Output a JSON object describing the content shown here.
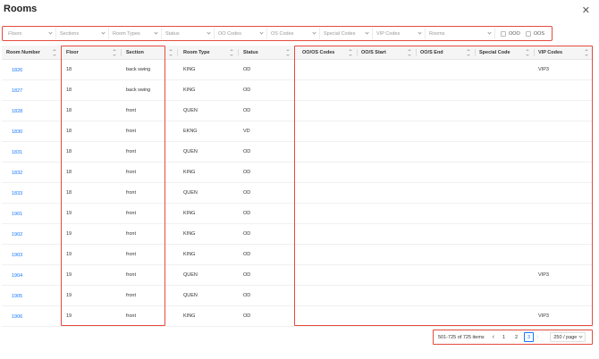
{
  "modal": {
    "title": "Rooms",
    "close_glyph": "✕"
  },
  "filters": {
    "floors": "Floors",
    "sections": "Sections",
    "room_types": "Room Types",
    "status": "Status",
    "oo_codes": "OO Codes",
    "os_codes": "OS Codes",
    "special_codes": "Special Codes",
    "vip_codes": "VIP Codes",
    "rooms": "Rooms",
    "ooo": "OOO",
    "oos": "OOS"
  },
  "columns": {
    "room_number": "Room Number",
    "floor": "Floor",
    "section": "Section",
    "room_type": "Room Type",
    "status": "Status",
    "oo_os_codes": "OO/OS Codes",
    "oo_s_start": "OO/S Start",
    "oo_s_end": "OO/S End",
    "special_code": "Special Code",
    "vip_codes": "VIP Codes"
  },
  "rows": [
    {
      "room": "1826",
      "floor": "18",
      "section": "back swing",
      "type": "KING",
      "status": "OD",
      "vip": "VIP3"
    },
    {
      "room": "1827",
      "floor": "18",
      "section": "back swing",
      "type": "KING",
      "status": "OD",
      "vip": ""
    },
    {
      "room": "1828",
      "floor": "18",
      "section": "front",
      "type": "QUEN",
      "status": "OD",
      "vip": ""
    },
    {
      "room": "1830",
      "floor": "18",
      "section": "front",
      "type": "EKNG",
      "status": "VD",
      "vip": ""
    },
    {
      "room": "1831",
      "floor": "18",
      "section": "front",
      "type": "QUEN",
      "status": "OD",
      "vip": ""
    },
    {
      "room": "1832",
      "floor": "18",
      "section": "front",
      "type": "KING",
      "status": "OD",
      "vip": ""
    },
    {
      "room": "1833",
      "floor": "18",
      "section": "front",
      "type": "QUEN",
      "status": "OD",
      "vip": ""
    },
    {
      "room": "1901",
      "floor": "19",
      "section": "front",
      "type": "KING",
      "status": "OD",
      "vip": ""
    },
    {
      "room": "1902",
      "floor": "19",
      "section": "front",
      "type": "KING",
      "status": "OD",
      "vip": ""
    },
    {
      "room": "1903",
      "floor": "19",
      "section": "front",
      "type": "KING",
      "status": "OD",
      "vip": ""
    },
    {
      "room": "1904",
      "floor": "19",
      "section": "front",
      "type": "QUEN",
      "status": "OD",
      "vip": "VIP3"
    },
    {
      "room": "1905",
      "floor": "19",
      "section": "front",
      "type": "QUEN",
      "status": "OD",
      "vip": ""
    },
    {
      "room": "1906",
      "floor": "19",
      "section": "front",
      "type": "KING",
      "status": "OD",
      "vip": "VIP3"
    }
  ],
  "pagination": {
    "range": "501-725 of 725 items",
    "pages": [
      "1",
      "2",
      "3"
    ],
    "current_page": "3",
    "prev_glyph": "‹",
    "next_glyph": "›",
    "page_size": "250 / page"
  },
  "colors": {
    "highlight": "#e54b3c",
    "link": "#1677ff"
  }
}
